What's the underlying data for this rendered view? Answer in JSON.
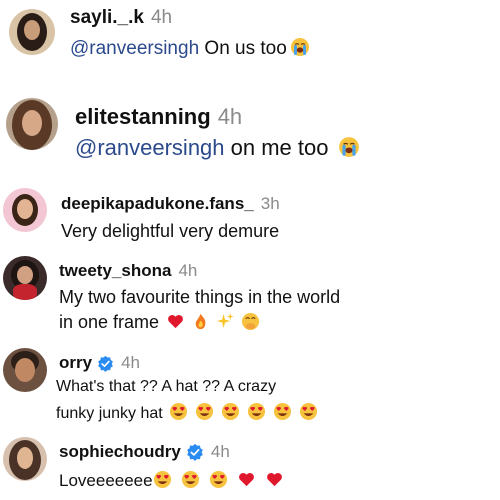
{
  "comments": [
    {
      "username": "sayli._.k",
      "time": "4h",
      "mention": "@ranveersingh",
      "text": " On us too"
    },
    {
      "username": "elitestanning",
      "time": "4h",
      "mention": "@ranveersingh",
      "text": " on me too"
    },
    {
      "username": "deepikapadukone.fans_",
      "time": "3h",
      "text": "Very delightful very demure"
    },
    {
      "username": "tweety_shona",
      "time": "4h",
      "line1": "My two favourite things in the world",
      "line2": "in one frame"
    },
    {
      "username": "orry",
      "time": "4h",
      "line1": "What's that ?? A hat ?? A crazy",
      "line2": "funky junky hat"
    },
    {
      "username": "sophiechoudry",
      "time": "4h",
      "text": "Loveeeeeee"
    }
  ],
  "icons": {
    "verified": "verified-badge-icon",
    "crying": "loudly-crying-face-emoji",
    "heart": "red-heart-emoji",
    "fire": "fire-emoji",
    "sparkles": "sparkles-emoji",
    "blush": "hand-over-mouth-emoji",
    "heart_eyes": "heart-eyes-emoji"
  },
  "colors": {
    "mention": "#2b4a8c",
    "verified": "#2a8bf2",
    "timestamp": "#8a8a8a"
  }
}
